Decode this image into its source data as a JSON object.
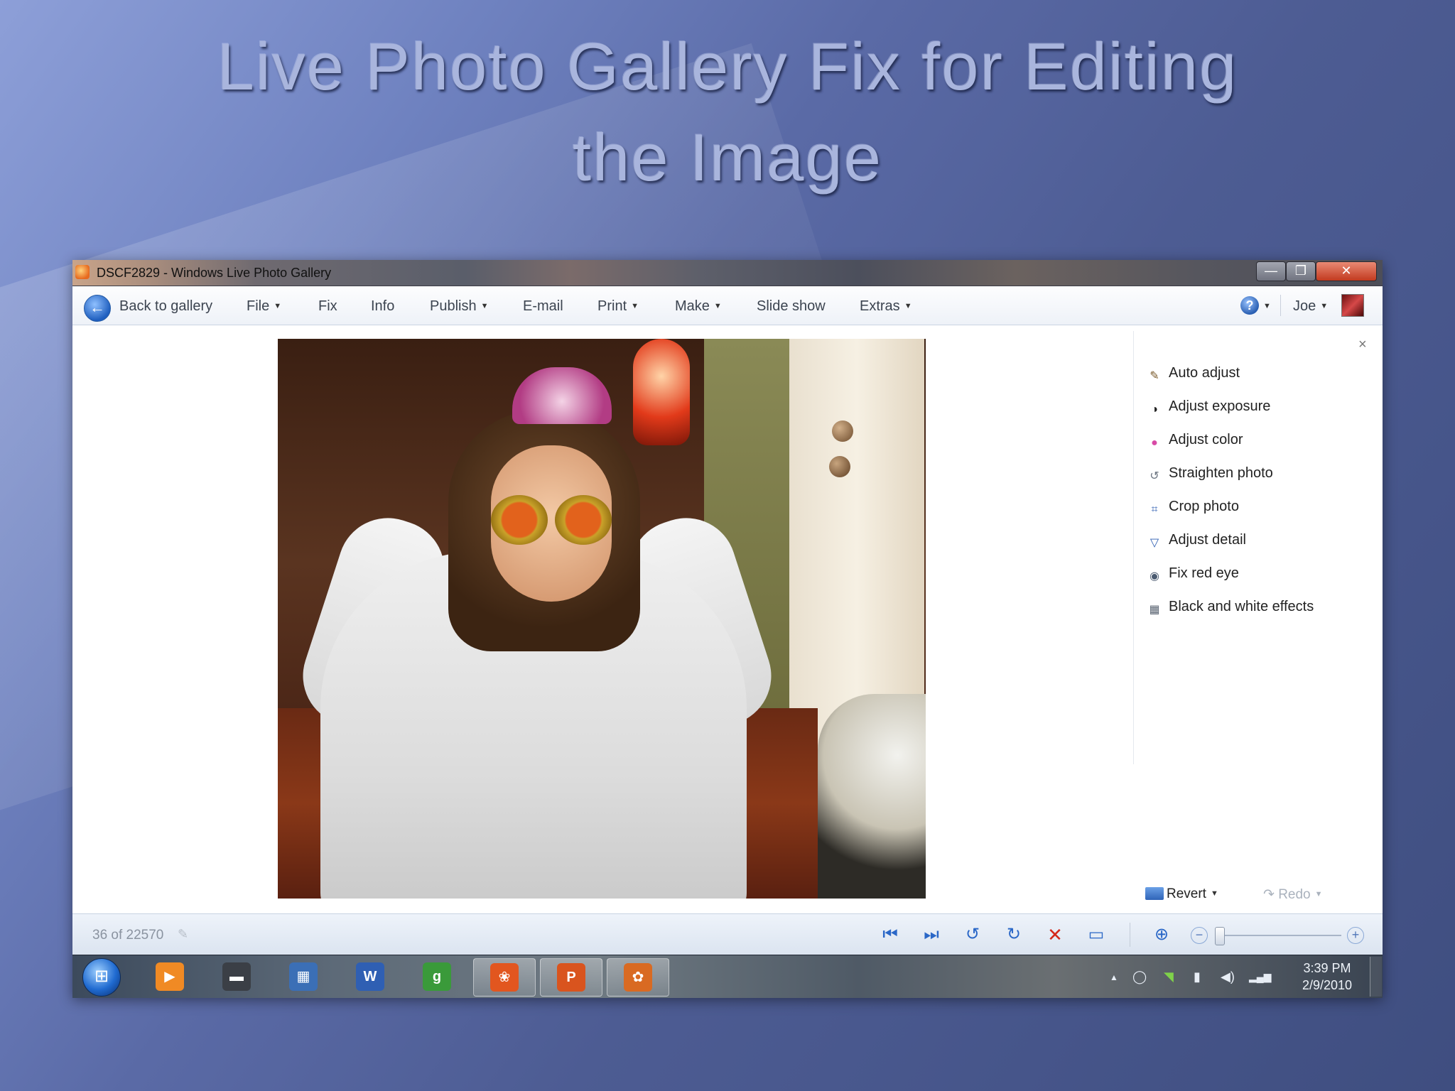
{
  "slide": {
    "title_line1": "Live Photo Gallery Fix for Editing",
    "title_line2": "the Image"
  },
  "window": {
    "title": "DSCF2829 - Windows Live Photo Gallery",
    "controls": {
      "minimize": "—",
      "maximize": "❐",
      "close": "✕"
    }
  },
  "menubar": {
    "back_label": "Back to gallery",
    "items": [
      {
        "label": "File",
        "dropdown": true
      },
      {
        "label": "Fix",
        "dropdown": false
      },
      {
        "label": "Info",
        "dropdown": false
      },
      {
        "label": "Publish",
        "dropdown": true
      },
      {
        "label": "E-mail",
        "dropdown": false
      },
      {
        "label": "Print",
        "dropdown": true
      },
      {
        "label": "Make",
        "dropdown": true
      },
      {
        "label": "Slide show",
        "dropdown": false
      },
      {
        "label": "Extras",
        "dropdown": true
      }
    ],
    "help_icon": "?",
    "user": "Joe"
  },
  "fix_panel": {
    "close_label": "×",
    "items": [
      {
        "label": "Auto adjust",
        "icon": "magic-wand-icon",
        "glyph": "✎",
        "color": "#7a5a2a"
      },
      {
        "label": "Adjust exposure",
        "icon": "exposure-icon",
        "glyph": "◑",
        "color": "#222222"
      },
      {
        "label": "Adjust color",
        "icon": "color-wheel-icon",
        "glyph": "●",
        "color": "#d84aa6"
      },
      {
        "label": "Straighten photo",
        "icon": "straighten-icon",
        "glyph": "↺",
        "color": "#6d7682"
      },
      {
        "label": "Crop photo",
        "icon": "crop-icon",
        "glyph": "⌗",
        "color": "#2a5bb0"
      },
      {
        "label": "Adjust detail",
        "icon": "detail-icon",
        "glyph": "▽",
        "color": "#2a5bb0"
      },
      {
        "label": "Fix red eye",
        "icon": "red-eye-icon",
        "glyph": "◉",
        "color": "#4a5a70"
      },
      {
        "label": "Black and white effects",
        "icon": "bw-effects-icon",
        "glyph": "▦",
        "color": "#5a6472"
      }
    ],
    "revert_label": "Revert",
    "redo_label": "Redo"
  },
  "statusbar": {
    "position_text": "36 of 22570",
    "controls": [
      {
        "name": "previous-button",
        "glyph": "⏮"
      },
      {
        "name": "next-button",
        "glyph": "⏭"
      },
      {
        "name": "rotate-left-button",
        "glyph": "↺"
      },
      {
        "name": "rotate-right-button",
        "glyph": "↻"
      },
      {
        "name": "delete-button",
        "glyph": "✕"
      },
      {
        "name": "slideshow-button",
        "glyph": "▭"
      },
      {
        "name": "actual-size-button",
        "glyph": "⊕"
      }
    ],
    "zoom_minus": "−",
    "zoom_plus": "+"
  },
  "taskbar": {
    "start_glyph": "⊞",
    "apps": [
      {
        "name": "media-player",
        "glyph": "▶",
        "color": "#f08a24",
        "active": false
      },
      {
        "name": "sony-vaio",
        "glyph": "▬",
        "color": "#3b3f46",
        "active": false
      },
      {
        "name": "network-computer",
        "glyph": "▦",
        "color": "#3b6fb6",
        "active": false
      },
      {
        "name": "word",
        "glyph": "W",
        "color": "#2f5fb3",
        "active": false
      },
      {
        "name": "google",
        "glyph": "g",
        "color": "#3a9a3a",
        "active": false
      },
      {
        "name": "photo-gallery-live",
        "glyph": "❀",
        "color": "#e2561f",
        "active": true
      },
      {
        "name": "powerpoint",
        "glyph": "P",
        "color": "#d9541e",
        "active": true
      },
      {
        "name": "photo-gallery",
        "glyph": "✿",
        "color": "#d96a22",
        "active": true
      }
    ],
    "tray": {
      "arrow": "▲",
      "icons": [
        "◯",
        "◥",
        "▮",
        "◀)",
        "▂▄▆"
      ]
    },
    "clock_time": "3:39 PM",
    "clock_date": "2/9/2010"
  }
}
